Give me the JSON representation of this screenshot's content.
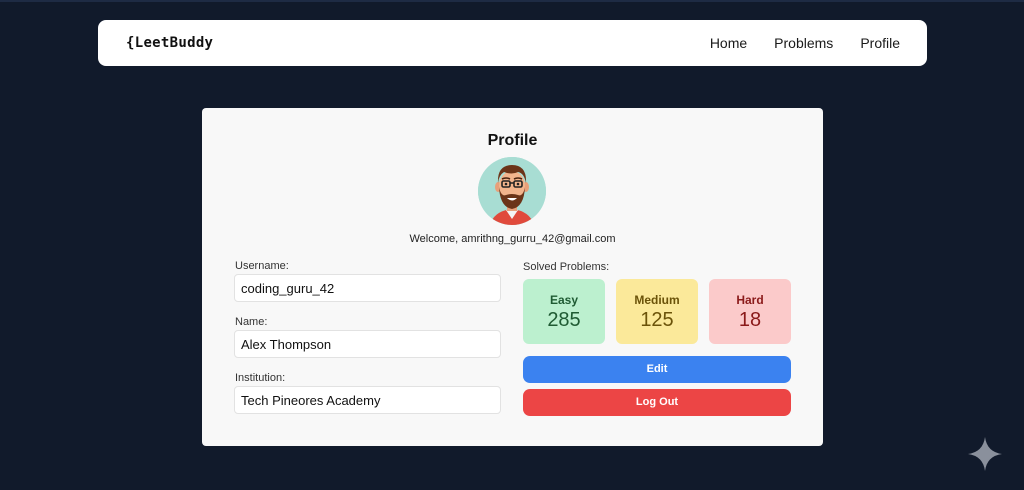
{
  "nav": {
    "logo": "{LeetBuddy",
    "links": [
      "Home",
      "Problems",
      "Profile"
    ]
  },
  "profile": {
    "title": "Profile",
    "welcome": "Welcome, amrithng_gurru_42@gmail.com",
    "fields": [
      {
        "label": "Username:",
        "value": "coding_guru_42"
      },
      {
        "label": "Name:",
        "value": "Alex Thompson"
      },
      {
        "label": "Institution:",
        "value": "Tech Pineores Academy"
      }
    ],
    "solved_label": "Solved Problems:",
    "stats": [
      {
        "name": "Easy",
        "value": "285",
        "color": "#bcf0cf"
      },
      {
        "name": "Medium",
        "value": "125",
        "color": "#fbe99a"
      },
      {
        "name": "Hard",
        "value": "18",
        "color": "#fbcaca"
      }
    ],
    "edit_label": "Edit",
    "logout_label": "Log Out"
  },
  "colors": {
    "background": "#111a2b",
    "edit_button": "#3b82f0",
    "logout_button": "#ec4545"
  },
  "icons": {
    "avatar": "bearded-man-with-glasses-avatar",
    "corner": "sparkle-icon"
  }
}
